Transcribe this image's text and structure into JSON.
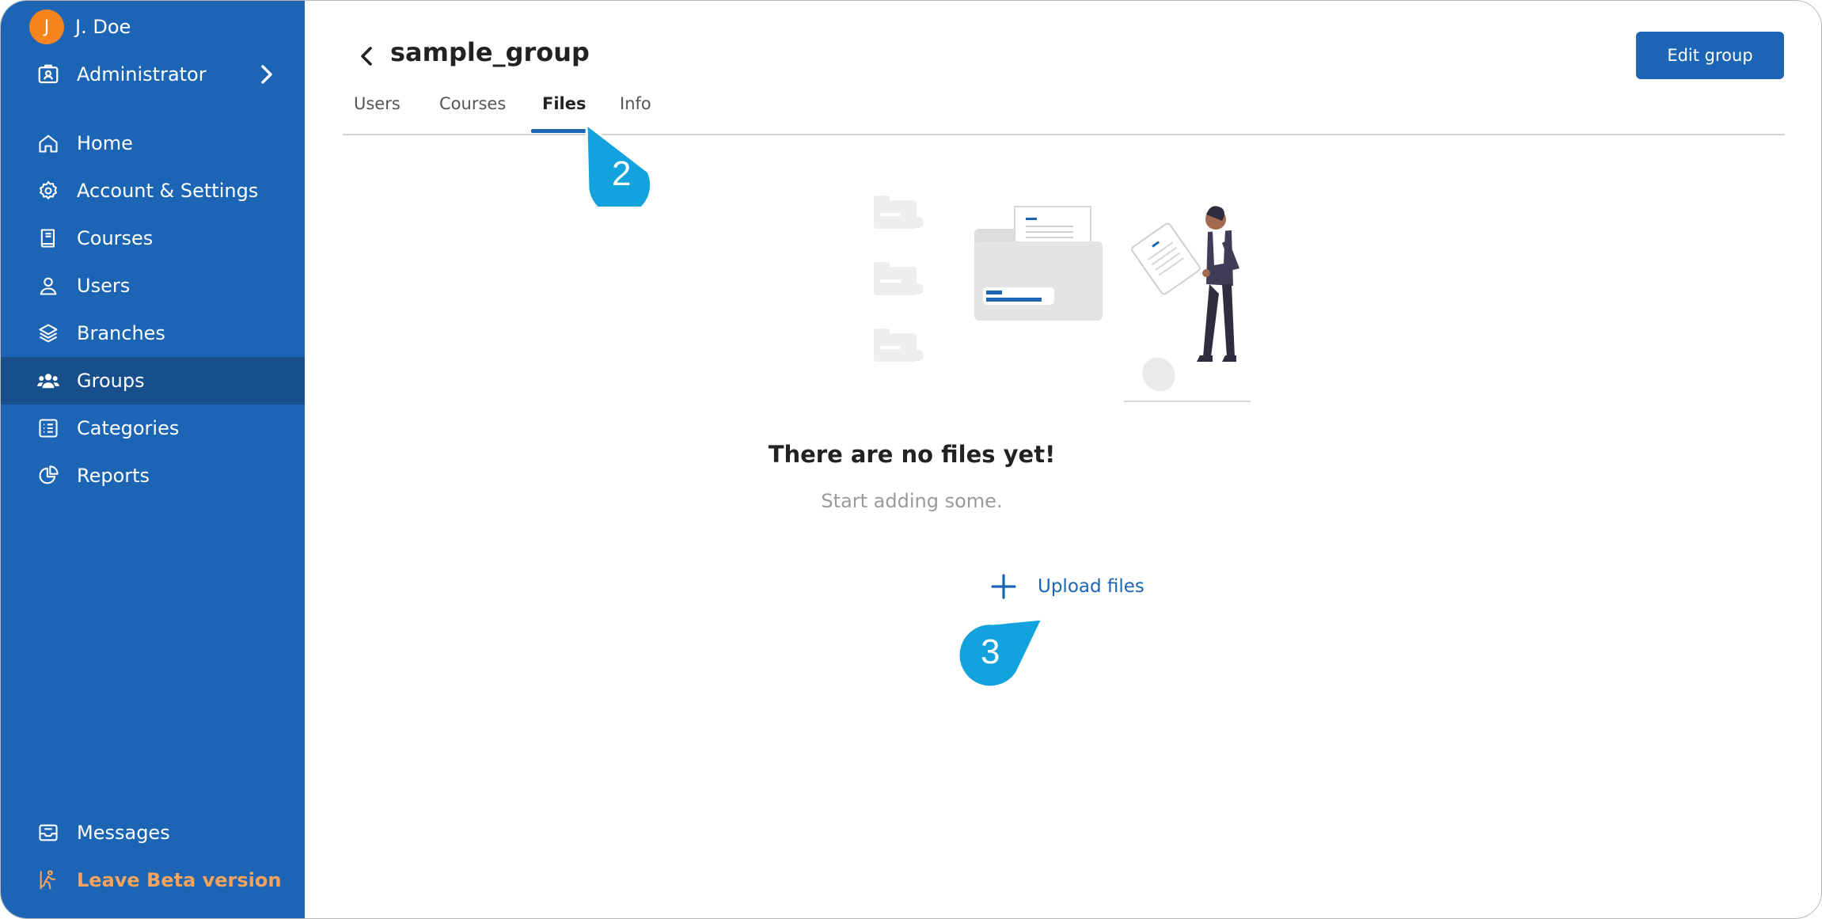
{
  "user": {
    "initial": "J",
    "name": "J. Doe"
  },
  "role": {
    "label": "Administrator"
  },
  "sidebar": {
    "items": [
      {
        "label": "Home",
        "icon": "home-icon"
      },
      {
        "label": "Account & Settings",
        "icon": "gear-icon"
      },
      {
        "label": "Courses",
        "icon": "book-icon"
      },
      {
        "label": "Users",
        "icon": "user-icon"
      },
      {
        "label": "Branches",
        "icon": "layers-icon"
      },
      {
        "label": "Groups",
        "icon": "users-group-icon",
        "active": true
      },
      {
        "label": "Categories",
        "icon": "list-icon"
      },
      {
        "label": "Reports",
        "icon": "pie-chart-icon"
      }
    ],
    "messages": {
      "label": "Messages",
      "icon": "inbox-icon"
    },
    "leave": {
      "label": "Leave Beta version",
      "icon": "exit-run-icon"
    }
  },
  "header": {
    "title": "sample_group",
    "edit_button": "Edit group"
  },
  "tabs": [
    {
      "label": "Users"
    },
    {
      "label": "Courses"
    },
    {
      "label": "Files",
      "active": true
    },
    {
      "label": "Info"
    }
  ],
  "empty_state": {
    "title": "There are no files yet!",
    "subtitle": "Start adding some.",
    "upload_label": "Upload files"
  },
  "callouts": [
    {
      "number": "2"
    },
    {
      "number": "3"
    }
  ],
  "colors": {
    "sidebar": "#1c65b4",
    "sidebar_active": "#174f8d",
    "accent": "#1c65b4",
    "avatar": "#f6841f",
    "leave": "#f7a35c",
    "callout": "#12a2dd"
  }
}
